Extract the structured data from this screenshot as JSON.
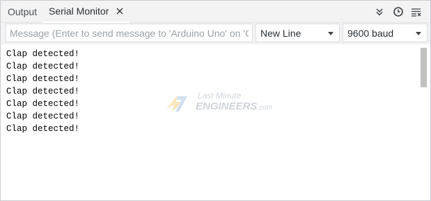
{
  "tabs": {
    "output_label": "Output",
    "serial_monitor_label": "Serial Monitor"
  },
  "toolbar": {
    "icons": [
      "chevron-double-down-icon",
      "clock-icon",
      "clear-lines-icon"
    ]
  },
  "input": {
    "placeholder": "Message (Enter to send message to 'Arduino Uno' on 'CO..."
  },
  "line_ending": {
    "selected": "New Line"
  },
  "baud_rate": {
    "selected": "9600 baud"
  },
  "output": {
    "lines": [
      "Clap detected!",
      "Clap detected!",
      "Clap detected!",
      "Clap detected!",
      "Clap detected!",
      "Clap detected!",
      "Clap detected!"
    ]
  },
  "watermark": {
    "line1": "Last Minute",
    "line2": "ENGINEERS",
    "suffix": ".com"
  },
  "colors": {
    "panel_bg": "#f3f3f3",
    "border": "#c9ccd0",
    "text": "#4e5257",
    "scrollbar": "#c1c1c1",
    "watermark_accent": "#f5b942"
  }
}
